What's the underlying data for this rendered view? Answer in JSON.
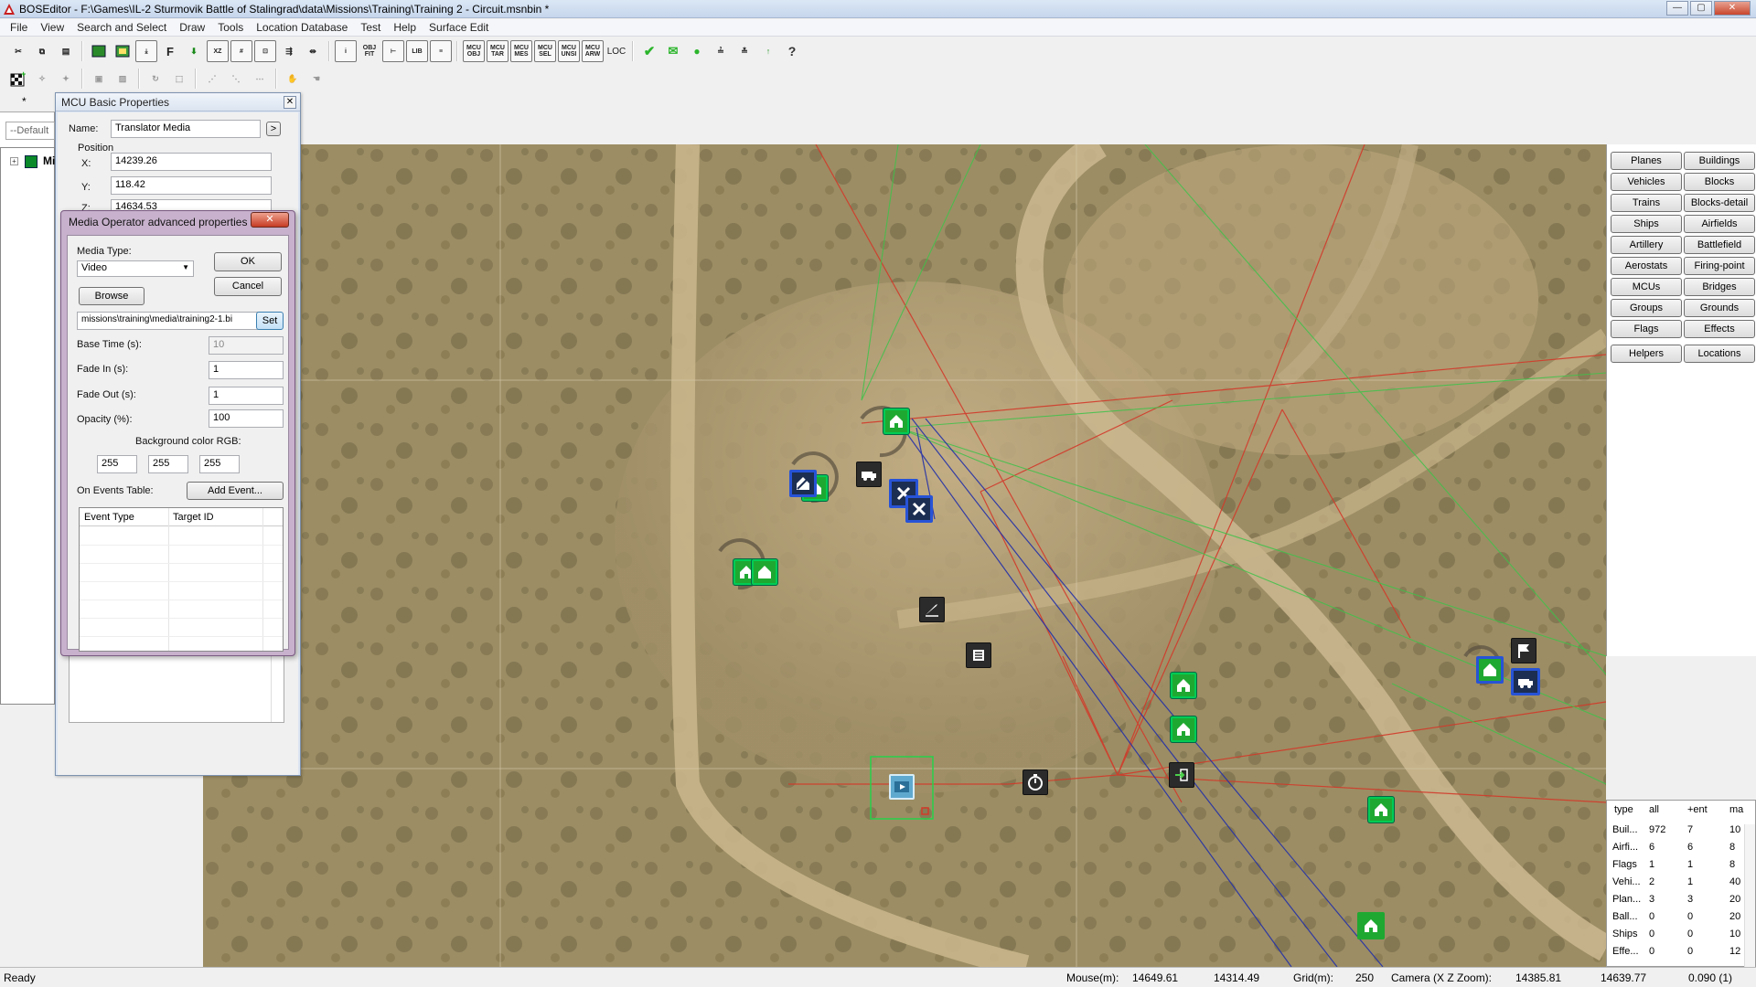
{
  "window": {
    "title": "BOSEditor - F:\\Games\\IL-2 Sturmovik Battle of Stalingrad\\data\\Missions\\Training\\Training 2 - Circuit.msnbin *"
  },
  "menu": [
    "File",
    "View",
    "Search and Select",
    "Draw",
    "Tools",
    "Location Database",
    "Test",
    "Help",
    "Surface Edit"
  ],
  "toolbar_text": {
    "f": "F",
    "loc": "LOC",
    "lib": "LIB",
    "obj": "OBJ",
    "fit": "FIT",
    "mcu_obj": "MCU OBJ",
    "mcu_tar": "MCU TAR",
    "mcu_mes": "MCU MES",
    "mcu_sel": "MCU SEL",
    "mcu_unsi": "MCU UNSI",
    "mcu_arw": "MCU ARW"
  },
  "left_panel": {
    "tab": "*",
    "combo": "--Default",
    "tree_root": "Mi"
  },
  "mcu_basic": {
    "title": "MCU Basic Properties",
    "name_label": "Name:",
    "name_value": "Translator Media",
    "arrow": ">",
    "position_label": "Position",
    "x_label": "X:",
    "x_value": "14239.26",
    "y_label": "Y:",
    "y_value": "118.42",
    "z_label": "Z:",
    "z_value": "14634.53"
  },
  "media_operator": {
    "title": "Media Operator advanced properties",
    "media_type_label": "Media Type:",
    "media_type_value": "Video",
    "ok": "OK",
    "cancel": "Cancel",
    "browse": "Browse",
    "path": "missions\\training\\media\\training2-1.bi",
    "set": "Set",
    "base_time_label": "Base Time (s):",
    "base_time_value": "10",
    "fade_in_label": "Fade In (s):",
    "fade_in_value": "1",
    "fade_out_label": "Fade Out (s):",
    "fade_out_value": "1",
    "opacity_label": "Opacity (%):",
    "opacity_value": "100",
    "bg_label": "Background color RGB:",
    "r": "255",
    "g": "255",
    "b": "255",
    "events_label": "On Events Table:",
    "add_event": "Add Event...",
    "col_event": "Event Type",
    "col_target": "Target ID"
  },
  "right_buttons": [
    [
      "Planes",
      "Buildings"
    ],
    [
      "Vehicles",
      "Blocks"
    ],
    [
      "Trains",
      "Blocks-detail"
    ],
    [
      "Ships",
      "Airfields"
    ],
    [
      "Artillery",
      "Battlefield"
    ],
    [
      "Aerostats",
      "Firing-point"
    ],
    [
      "MCUs",
      "Bridges"
    ],
    [
      "Groups",
      "Grounds"
    ],
    [
      "Flags",
      "Effects"
    ],
    [
      "Helpers",
      "Locations"
    ]
  ],
  "stats": {
    "headers": [
      "type",
      "all",
      "+ent",
      "ma"
    ],
    "rows": [
      [
        "Buil...",
        "972",
        "7",
        "10"
      ],
      [
        "Airfi...",
        "6",
        "6",
        "8"
      ],
      [
        "Flags",
        "1",
        "1",
        "8"
      ],
      [
        "Vehi...",
        "2",
        "1",
        "40"
      ],
      [
        "Plan...",
        "3",
        "3",
        "20"
      ],
      [
        "Ball...",
        "0",
        "0",
        "20"
      ],
      [
        "Ships",
        "0",
        "0",
        "10"
      ],
      [
        "Effe...",
        "0",
        "0",
        "12"
      ]
    ]
  },
  "status": {
    "ready": "Ready",
    "mouse_label": "Mouse(m):",
    "mouse_x": "14649.61",
    "mouse_z": "14314.49",
    "grid_label": "Grid(m):",
    "grid_value": "250",
    "camera_label": "Camera (X Z Zoom):",
    "camera_x": "14385.81",
    "camera_z": "14639.77",
    "zoom": "0.090 (1)"
  },
  "colors": {
    "green_marker": "#1fa831",
    "blue_selection": "#2753d6",
    "red_link": "#d23a2a",
    "green_link": "#3fc24a",
    "blue_link": "#2330a8"
  }
}
